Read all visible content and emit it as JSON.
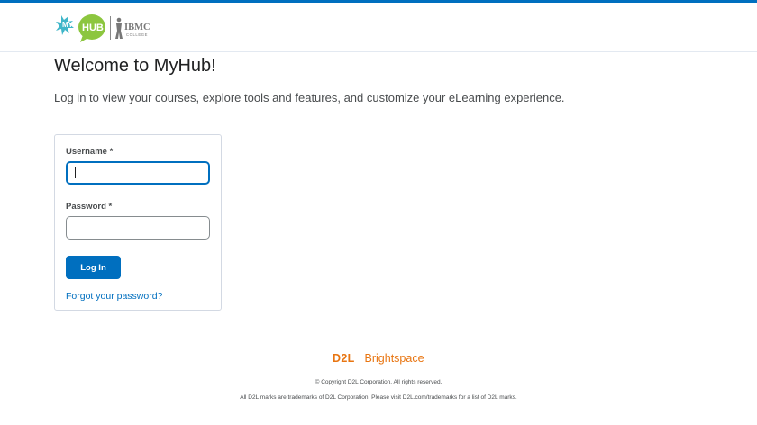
{
  "header": {
    "logo_primary_text": "MY HUB",
    "logo_secondary_text": "IBMC COLLEGE"
  },
  "main": {
    "title": "Welcome to MyHub!",
    "subtitle": "Log in to view your courses, explore tools and features, and customize your eLearning experience."
  },
  "login_form": {
    "username_label": "Username *",
    "username_value": "",
    "password_label": "Password *",
    "password_value": "",
    "login_button_label": "Log In",
    "forgot_link_label": "Forgot your password?"
  },
  "footer": {
    "brand_mark": "D2L",
    "brand_name": "Brightspace",
    "copyright": "© Copyright D2L Corporation. All rights reserved.",
    "trademark": "All D2L marks are trademarks of D2L Corporation. Please visit D2L.com/trademarks for a list of D2L marks."
  },
  "colors": {
    "accent": "#006fbf",
    "brand_orange": "#e87511",
    "logo_teal": "#3fb6c9",
    "logo_green": "#8cc63f"
  },
  "icons": {
    "logo": "myhub-ibmc-logo"
  }
}
